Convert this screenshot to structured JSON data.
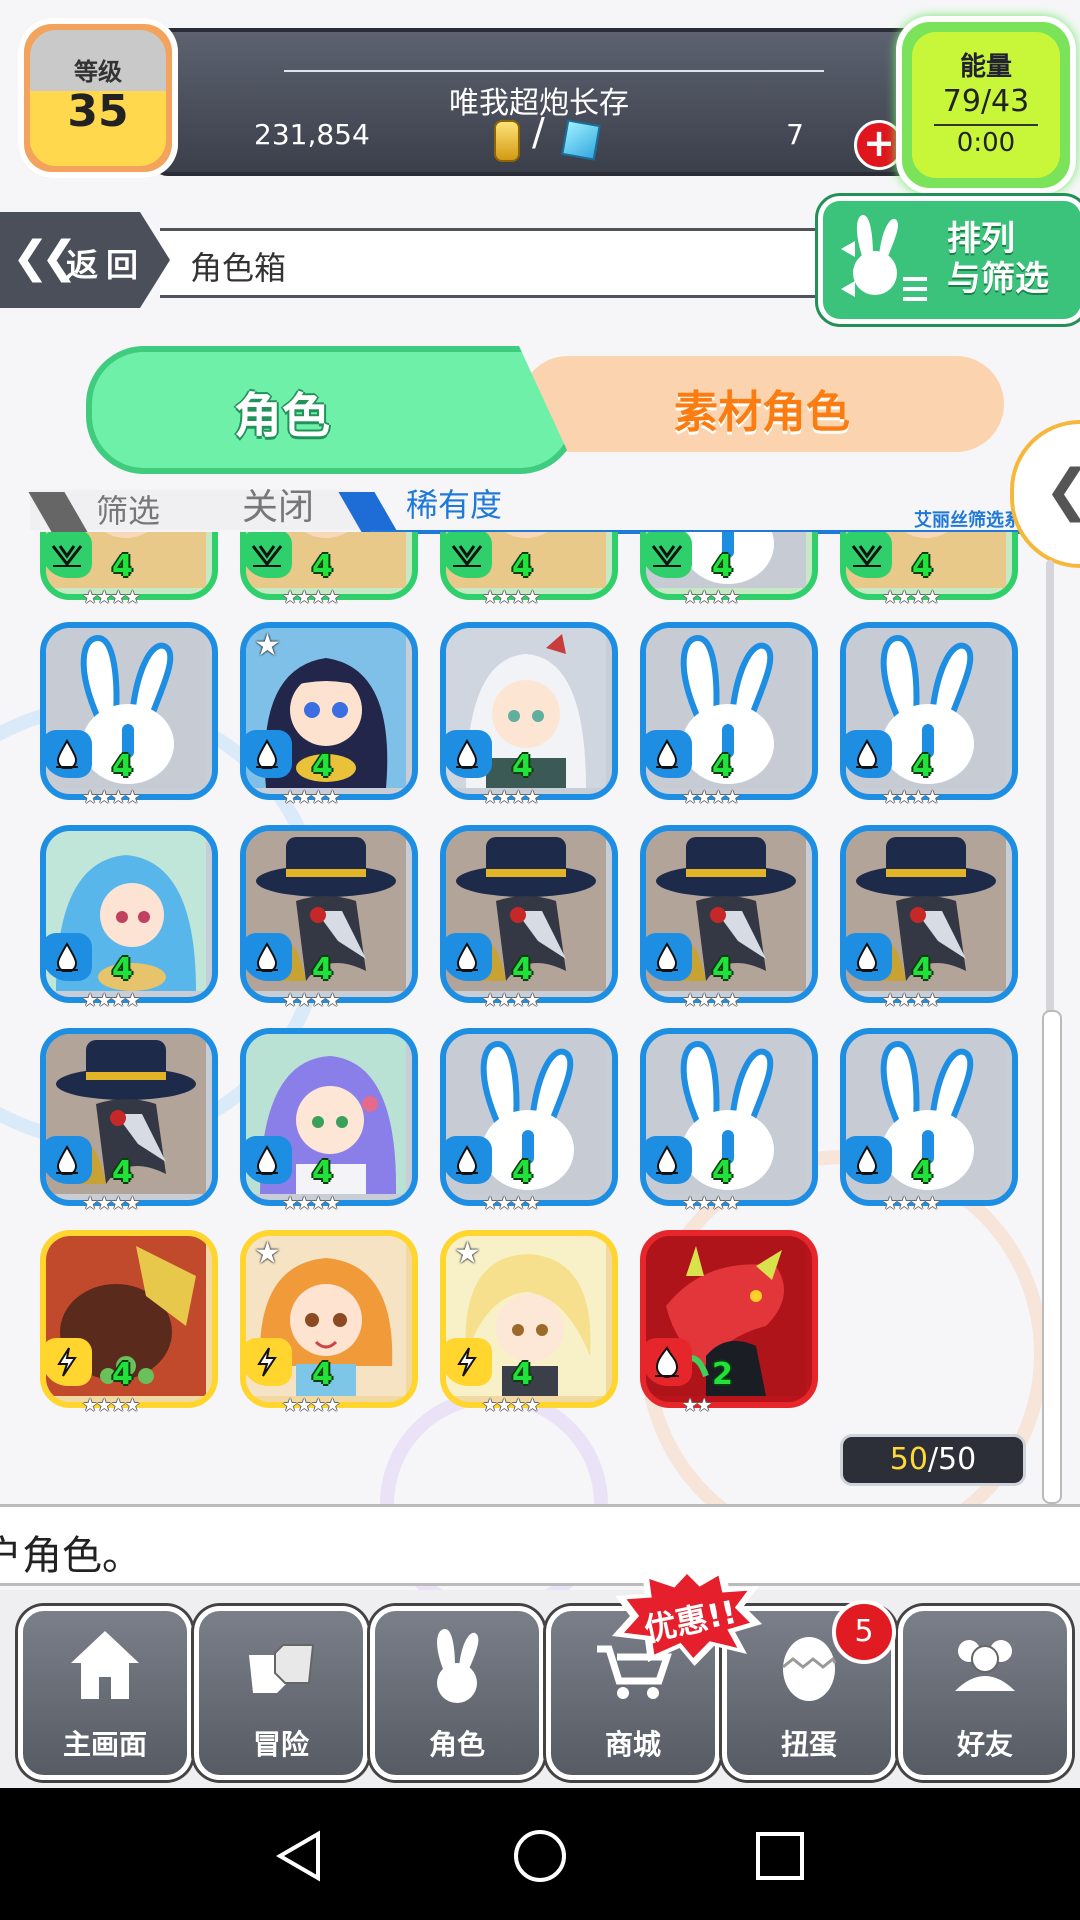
{
  "header": {
    "level_label": "等级",
    "level_value": "35",
    "player_name": "唯我超炮长存",
    "gold": "231,854",
    "gems": "7",
    "energy_label": "能量",
    "energy_value": "79/43",
    "energy_timer": "0:00"
  },
  "nav": {
    "back_label": "返回",
    "page_title": "角色箱",
    "sort_label_line1": "排列",
    "sort_label_line2": "与筛选"
  },
  "tabs": {
    "characters": "角色",
    "material": "素材角色"
  },
  "filter": {
    "filter_label": "筛选",
    "filter_state": "关闭",
    "sort_by": "稀有度",
    "system_label": "艾丽丝筛选系统"
  },
  "grid": {
    "cards": [
      {
        "element": "wood",
        "level": "4",
        "stars": "★★★★",
        "portrait": "character",
        "corner_star": false
      },
      {
        "element": "wood",
        "level": "4",
        "stars": "★★★★",
        "portrait": "character",
        "corner_star": false
      },
      {
        "element": "wood",
        "level": "4",
        "stars": "★★★★",
        "portrait": "character",
        "corner_star": false
      },
      {
        "element": "wood",
        "level": "4",
        "stars": "★★★★",
        "portrait": "bunny",
        "corner_star": false
      },
      {
        "element": "wood",
        "level": "4",
        "stars": "★★★★",
        "portrait": "character",
        "corner_star": false
      },
      {
        "element": "water",
        "level": "4",
        "stars": "★★★★",
        "portrait": "bunny",
        "corner_star": false
      },
      {
        "element": "water",
        "level": "4",
        "stars": "★★★★",
        "portrait": "girl-dark-hair",
        "corner_star": true
      },
      {
        "element": "water",
        "level": "4",
        "stars": "★★★★",
        "portrait": "girl-white-hair",
        "corner_star": false
      },
      {
        "element": "water",
        "level": "4",
        "stars": "★★★★",
        "portrait": "bunny",
        "corner_star": false
      },
      {
        "element": "water",
        "level": "4",
        "stars": "★★★★",
        "portrait": "bunny",
        "corner_star": false
      },
      {
        "element": "water",
        "level": "4",
        "stars": "★★★★",
        "portrait": "girl-blue-hair",
        "corner_star": false
      },
      {
        "element": "water",
        "level": "4",
        "stars": "★★★★",
        "portrait": "plague-doctor",
        "corner_star": false
      },
      {
        "element": "water",
        "level": "4",
        "stars": "★★★★",
        "portrait": "plague-doctor",
        "corner_star": false
      },
      {
        "element": "water",
        "level": "4",
        "stars": "★★★★",
        "portrait": "plague-doctor",
        "corner_star": false
      },
      {
        "element": "water",
        "level": "4",
        "stars": "★★★★",
        "portrait": "plague-doctor",
        "corner_star": false
      },
      {
        "element": "water",
        "level": "4",
        "stars": "★★★★",
        "portrait": "plague-doctor",
        "corner_star": false
      },
      {
        "element": "water",
        "level": "4",
        "stars": "★★★★",
        "portrait": "girl-purple-hair",
        "corner_star": false
      },
      {
        "element": "water",
        "level": "4",
        "stars": "★★★★",
        "portrait": "bunny",
        "corner_star": false
      },
      {
        "element": "water",
        "level": "4",
        "stars": "★★★★",
        "portrait": "bunny",
        "corner_star": false
      },
      {
        "element": "water",
        "level": "4",
        "stars": "★★★★",
        "portrait": "bunny",
        "corner_star": false
      },
      {
        "element": "thunder",
        "level": "4",
        "stars": "★★★★",
        "portrait": "beast-warrior",
        "corner_star": false
      },
      {
        "element": "thunder",
        "level": "4",
        "stars": "★★★★",
        "portrait": "girl-orange-hair",
        "corner_star": true
      },
      {
        "element": "thunder",
        "level": "4",
        "stars": "★★★★",
        "portrait": "boy-blonde",
        "corner_star": true
      },
      {
        "element": "fire",
        "level": "2",
        "stars": "★★",
        "portrait": "red-dragon",
        "corner_star": false
      }
    ]
  },
  "counter": {
    "current": "50",
    "separator": "/",
    "max": "50"
  },
  "message": "户角色。",
  "bottom_nav": {
    "items": [
      {
        "label": "主画面",
        "icon": "home-icon"
      },
      {
        "label": "冒险",
        "icon": "fist-bump-icon"
      },
      {
        "label": "角色",
        "icon": "bunny-icon"
      },
      {
        "label": "商城",
        "icon": "cart-icon"
      },
      {
        "label": "扭蛋",
        "icon": "egg-icon"
      },
      {
        "label": "好友",
        "icon": "friends-icon"
      }
    ],
    "promo_label": "优惠!!",
    "gacha_badge": "5"
  },
  "colors": {
    "water": "#1e8ee3",
    "wood": "#2fd06b",
    "thunder": "#ffd52e",
    "fire": "#e6262b",
    "tab_active": "#6ef0a8",
    "tab_inactive": "#fbd3ae"
  }
}
